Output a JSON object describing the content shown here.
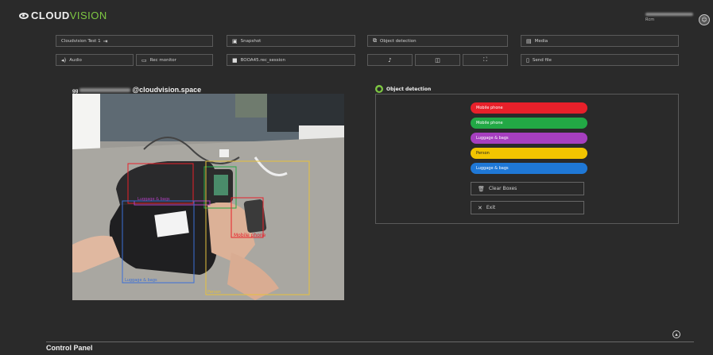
{
  "brand": {
    "part1": "CLOUD",
    "part2": "VISION"
  },
  "user": {
    "short": "Rcm"
  },
  "toolbar": {
    "row1": [
      {
        "label": "Cloudvision Test 1",
        "icon": "sign-out-icon"
      },
      {
        "label": "Snapshot",
        "icon": "snapshot-icon"
      },
      {
        "label": "Object detection",
        "icon": "detection-icon"
      },
      {
        "label": "Media",
        "icon": "folder-icon"
      }
    ],
    "row2": [
      {
        "label": "Audio",
        "icon": "speaker-icon"
      },
      {
        "label": "Rec monitor",
        "icon": "monitor-icon"
      },
      {
        "label": "BOOA45.rec_session",
        "icon": "camera-icon"
      },
      {
        "label": "",
        "icon": "microphone-icon"
      },
      {
        "label": "",
        "icon": "picture-in-picture-icon"
      },
      {
        "label": "",
        "icon": "fullscreen-icon"
      },
      {
        "label": "Send file",
        "icon": "file-icon"
      }
    ]
  },
  "video": {
    "title_suffix": "@cloudvision.space",
    "title_prefix": "gg",
    "detections": [
      {
        "label": "Mobile phone",
        "color": "#e8202a"
      },
      {
        "label": "Luggage & bags",
        "color": "#b040c0"
      },
      {
        "label": "Luggage & bags",
        "color": "#3b6fd6"
      },
      {
        "label": "Person",
        "color": "#e6c13a"
      }
    ]
  },
  "object_detection": {
    "title": "Object detection",
    "categories": [
      {
        "label": "Mobile phone",
        "color": "#e8202a"
      },
      {
        "label": "Mobile phone",
        "color": "#22a845"
      },
      {
        "label": "Luggage & bags",
        "color": "#a63fbf"
      },
      {
        "label": "Person",
        "color": "#f2c500"
      },
      {
        "label": "Luggage & bags",
        "color": "#1f78d6"
      }
    ],
    "clear_label": "Clear Boxes",
    "exit_label": "Exit"
  },
  "control_panel": {
    "title": "Control Panel"
  },
  "colors": {
    "accent": "#7ec843",
    "background": "#2a2a2a"
  }
}
